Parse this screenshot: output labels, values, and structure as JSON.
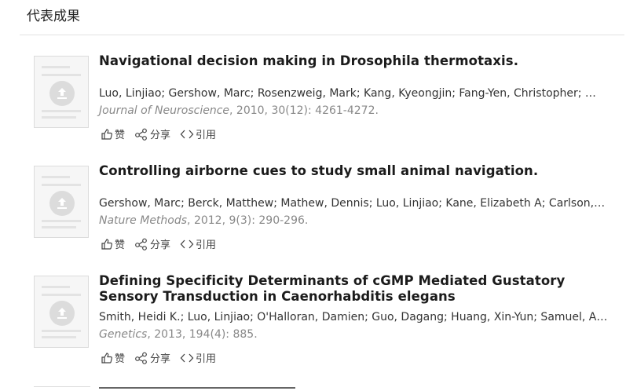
{
  "section": {
    "title": "代表成果"
  },
  "papers": [
    {
      "title": "Navigational decision making in Drosophila thermotaxis.",
      "authors": "Luo, Linjiao; Gershow, Marc; Rosenzweig, Mark; Kang, Kyeongjin; Fang-Yen, Christopher; …",
      "journal": "Journal of Neuroscience",
      "details": ", 2010, 30(12): 4261-4272."
    },
    {
      "title": "Controlling airborne cues to study small animal navigation.",
      "authors": "Gershow, Marc; Berck, Matthew; Mathew, Dennis; Luo, Linjiao; Kane, Elizabeth A; Carlson,…",
      "journal": "Nature Methods",
      "details": ", 2012, 9(3): 290-296."
    },
    {
      "title": "Defining Specificity Determinants of cGMP Mediated Gustatory Sensory Transduction in Caenorhabditis elegans",
      "authors": "Smith, Heidi K.; Luo, Linjiao; O'Halloran, Damien; Guo, Dagang; Huang, Xin-Yun; Samuel, A…",
      "journal": "Genetics",
      "details": ", 2013, 194(4): 885."
    }
  ],
  "actions": {
    "like": "赞",
    "share": "分享",
    "cite": "引用"
  },
  "icons": {
    "thumbnail": "upload-icon",
    "like": "thumbs-up-icon",
    "share": "share-icon",
    "cite": "code-brackets-icon"
  }
}
